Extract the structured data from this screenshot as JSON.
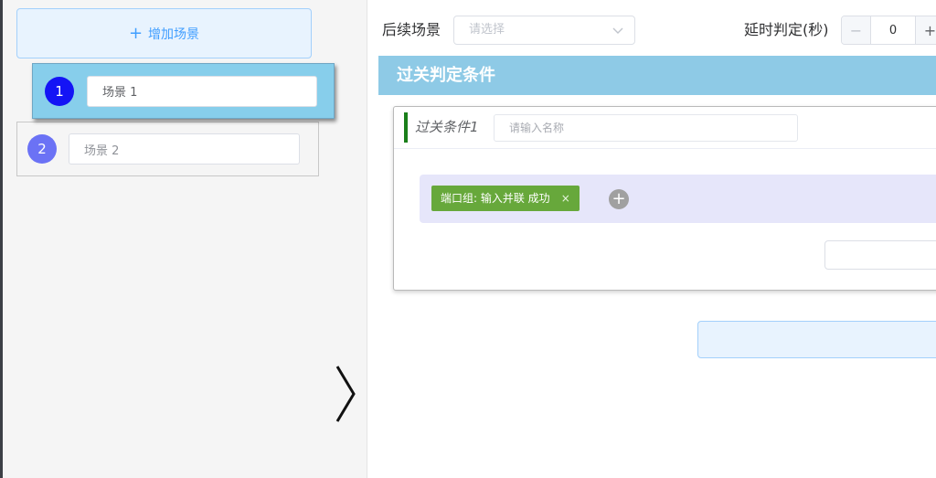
{
  "left": {
    "add_scene": {
      "icon": "plus-icon",
      "plus_glyph": "+",
      "label": "增加场景"
    },
    "scenes": [
      {
        "number": "1",
        "name": "场景 1",
        "selected": true
      },
      {
        "number": "2",
        "name": "场景 2",
        "selected": false
      }
    ],
    "collapse_icon": "chevron-right-icon"
  },
  "right": {
    "next_scene": {
      "label": "后续场景",
      "placeholder": "请选择"
    },
    "delay": {
      "label": "延时判定(秒)",
      "value": "0",
      "minus": "−",
      "plus": "+"
    },
    "section_title": "过关判定条件",
    "condition": {
      "title": "过关条件1",
      "name_placeholder": "请输入名称",
      "tag_label": "端口组: 输入并联 成功",
      "tag_close": "×",
      "add_glyph": "+"
    }
  },
  "colors": {
    "accent": "#409eff",
    "scene_active_bg": "#87ceeb",
    "scene1_badge": "#1414f5",
    "scene2_badge": "#6b72f5",
    "header_bg": "#8ecae6",
    "tag_bg": "#67a83b",
    "port_area_bg": "#e6e6fa",
    "condition_marker": "#1a7f1a"
  }
}
